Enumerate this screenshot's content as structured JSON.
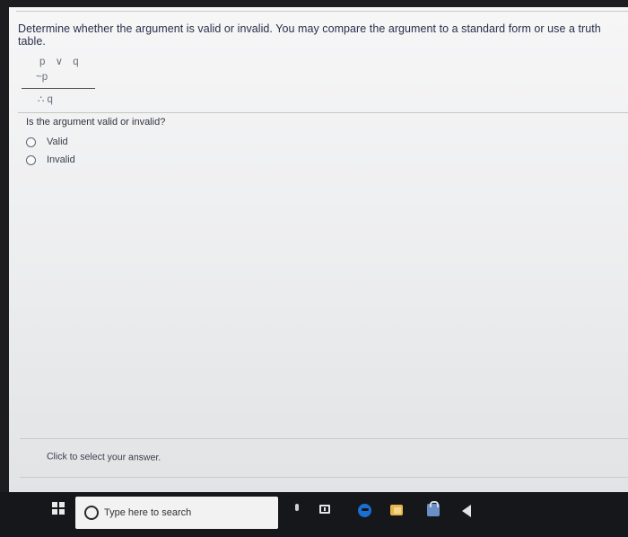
{
  "question": {
    "text": "Determine whether the argument is valid or invalid. You may compare the argument to a standard form or use a truth table."
  },
  "argument": {
    "premise1": "p ∨ q",
    "premise2": "~p",
    "conclusion": "∴ q"
  },
  "prompt": "Is the argument valid or invalid?",
  "options": [
    {
      "label": "Valid"
    },
    {
      "label": "Invalid"
    }
  ],
  "answer_hint": "Click to select your answer.",
  "taskbar": {
    "search_placeholder": "Type here to search",
    "icons": [
      "windows-start-icon",
      "cortana-icon",
      "microphone-icon",
      "task-view-icon",
      "edge-browser-icon",
      "file-explorer-icon",
      "store-icon",
      "app-icon"
    ]
  }
}
